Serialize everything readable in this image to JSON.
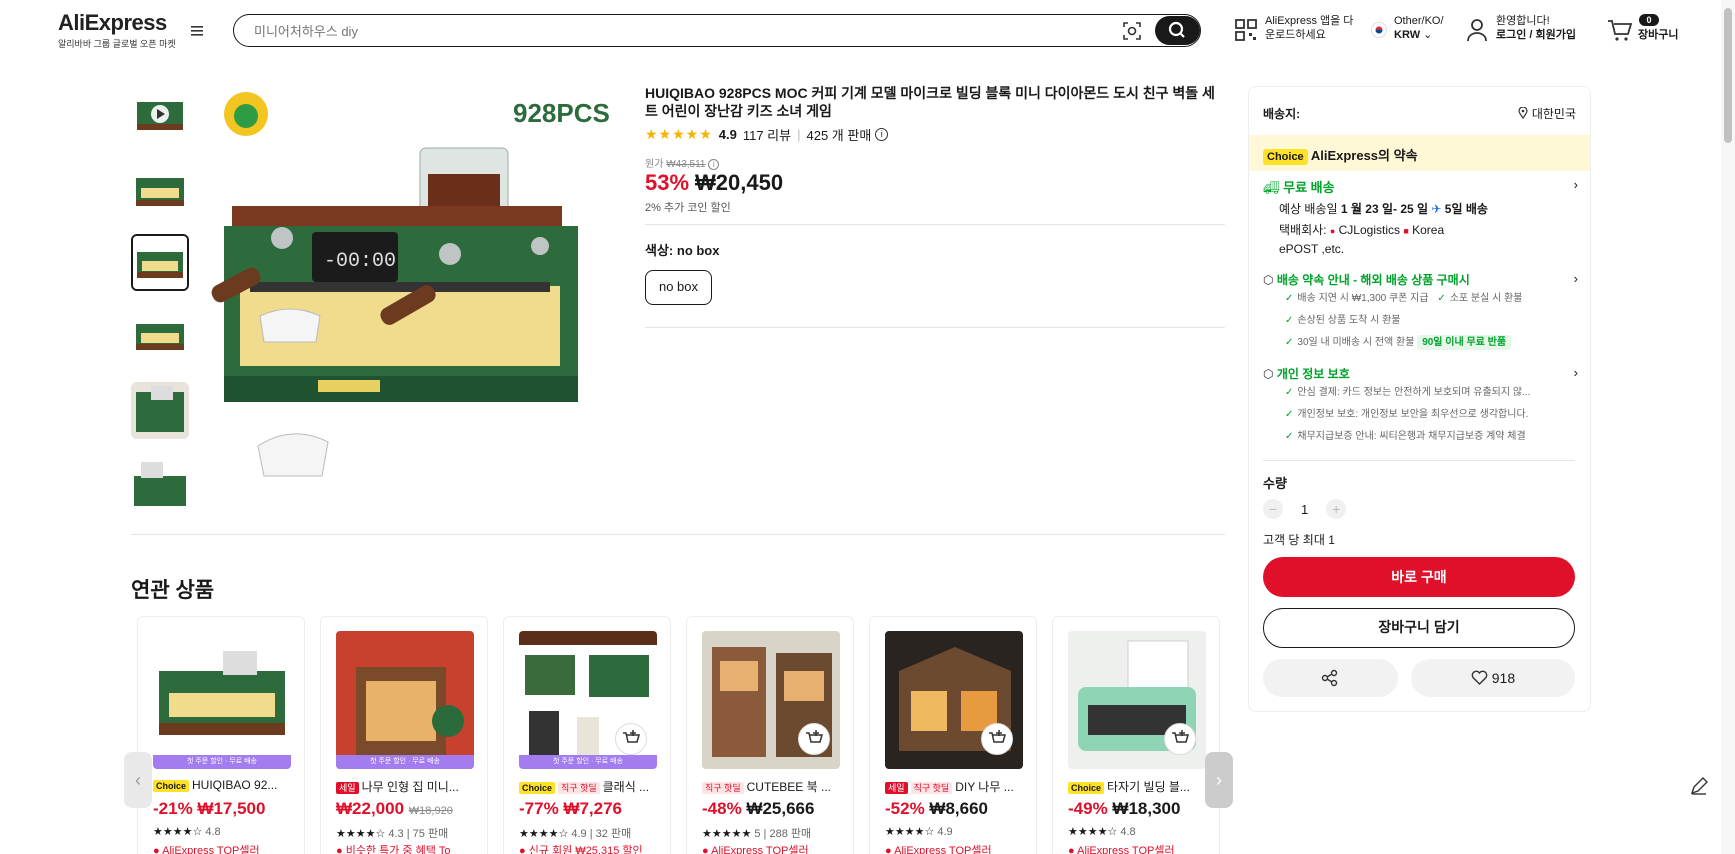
{
  "header": {
    "brand": "AliExpress",
    "tagline": "알리바바 그룹 글로벌 오픈 마켓",
    "search_placeholder": "미니어처하우스 diy",
    "app_line1": "AliExpress 앱을 다",
    "app_line2": "운로드하세요",
    "locale_line1": "Other/KO/",
    "locale_line2": "KRW",
    "account_line1": "환영합니다!",
    "account_line2": "로그인 / 회원가입",
    "cart_count": "0",
    "cart_label": "장바구니"
  },
  "product": {
    "image_badge": "928PCS",
    "title": "HUIQIBAO 928PCS MOC 커피 기계 모델 마이크로 빌딩 블록 미니 다이아몬드 도시 친구 벽돌 세트 어린이 장난감 키즈 소녀 게임",
    "rating": "4.9",
    "reviews": "117 리뷰",
    "sold": "425 개 판매",
    "original_price_label": "원가",
    "original_price": "₩43,511",
    "discount": "53%",
    "price": "₩20,450",
    "coin_note": "2% 추가 코인 할인",
    "color_label": "색상:",
    "color_value": "no box",
    "sku_option": "no box"
  },
  "panel": {
    "ship_to": "배송지:",
    "country": "대한민국",
    "choice_tag": "Choice",
    "promise": "AliExpress의 약속",
    "free_shipping": "무료 배송",
    "delivery_prefix": "예상 배송일",
    "delivery_dates": "1 월 23 일- 25 일",
    "delivery_days": "5일 배송",
    "courier_label": "택배회사:",
    "courier1": "CJLogistics",
    "courier2": "Korea",
    "courier3": "ePOST ,etc.",
    "guarantee_title": "배송 약속 안내 - 해외 배송 상품 구매시",
    "g1": "배송 지연 시 ₩1,300 쿠폰 지급",
    "g2": "소포 분실 시 환불",
    "g3": "손상된 상품 도착 시 환불",
    "g4": "30일 내 미배송 시 전액 환불",
    "g4_badge": "90일 이내 무료 반품",
    "privacy_title": "개인 정보 보호",
    "p1": "안심 결제: 카드 정보는 안전하게 보호되며 유출되지 않...",
    "p2": "개인정보 보호: 개인정보 보안을 최우선으로 생각합니다.",
    "p3": "채무지급보증 안내: 씨티은행과 채무지급보증 계약 체결",
    "qty_label": "수량",
    "qty_value": "1",
    "max_note": "고객 당 최대 1",
    "buy_now": "바로 구매",
    "add_to_cart": "장바구니 담기",
    "wishlist_count": "918"
  },
  "related": {
    "title": "연관 상품",
    "items": [
      {
        "tag": "Choice",
        "name": "HUIQIBAO 92...",
        "discount": "-21%",
        "price": "₩17,500",
        "orig": "",
        "rating": "4.8",
        "sold": "",
        "seller": "AliExpress TOP셀러",
        "strip": "첫 주문 할인 · 무료 배송"
      },
      {
        "tag": "세일",
        "name": "나무 인형 집 미니...",
        "discount": "",
        "price": "₩22,000",
        "orig": "₩18,920",
        "rating": "4.3",
        "sold": "75 판매",
        "seller": "비슷한 특가 중 혜택 To",
        "strip": "첫 주문 할인 · 무료 배송"
      },
      {
        "tag": "Choice",
        "tag2": "직구 핫딜",
        "name": "클래식 ...",
        "discount": "-77%",
        "price": "₩7,276",
        "orig": "",
        "rating": "4.9",
        "sold": "32 판매",
        "seller": "신규 회원 ₩25,315 할인",
        "strip": "첫 주문 할인 · 무료 배송"
      },
      {
        "tag": "직구 핫딜",
        "name": "CUTEBEE 북 ...",
        "discount": "-48%",
        "price": "₩25,666",
        "orig": "",
        "rating": "5",
        "sold": "288 판매",
        "seller": "AliExpress TOP셀러",
        "strip": ""
      },
      {
        "tag": "세일",
        "tag2": "직구 핫딜",
        "name": "DIY 나무 ...",
        "discount": "-52%",
        "price": "₩8,660",
        "orig": "",
        "rating": "4.9",
        "sold": "",
        "seller": "AliExpress TOP셀러",
        "strip": ""
      },
      {
        "tag": "Choice",
        "name": "타자기 빌딩 블...",
        "discount": "-49%",
        "price": "₩18,300",
        "orig": "",
        "rating": "4.8",
        "sold": "",
        "seller": "AliExpress TOP셀러",
        "strip": ""
      }
    ]
  },
  "icons": [
    "menu-icon",
    "camera-search-icon",
    "search-icon",
    "qr-code-icon",
    "korea-flag-icon",
    "user-icon",
    "cart-icon",
    "play-icon",
    "info-icon",
    "location-pin-icon",
    "truck-icon",
    "plane-icon",
    "shield-icon",
    "lock-icon",
    "chevron-right-icon",
    "checkmark-icon",
    "share-icon",
    "heart-icon",
    "add-to-cart-icon",
    "arrow-left-icon",
    "arrow-right-icon",
    "edit-icon"
  ],
  "colors": {
    "accent": "#e0102a",
    "green": "#00a32a",
    "choice": "#ffe227",
    "dark": "#191919"
  }
}
